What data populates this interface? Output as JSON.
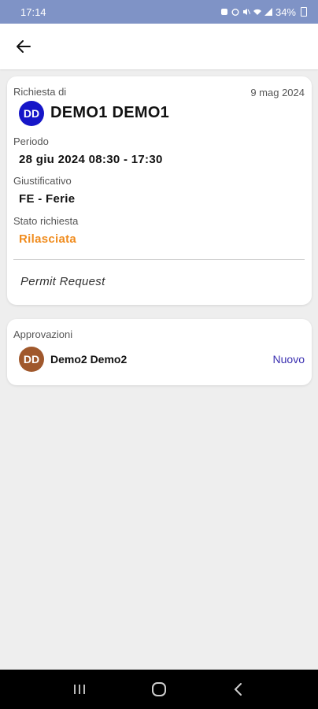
{
  "status_bar": {
    "time": "17:14",
    "battery": "34%"
  },
  "request": {
    "requested_by_label": "Richiesta di",
    "date": "9 mag 2024",
    "requester_initials": "DD",
    "requester_name": "DEMO1 DEMO1",
    "period_label": "Periodo",
    "period_value": "28 giu 2024 08:30 - 17:30",
    "justification_label": "Giustificativo",
    "justification_value": "FE - Ferie",
    "status_label": "Stato richiesta",
    "status_value": "Rilasciata",
    "note": "Permit Request"
  },
  "approvals": {
    "title": "Approvazioni",
    "items": [
      {
        "initials": "DD",
        "name": "Demo2 Demo2",
        "status": "Nuovo"
      }
    ]
  },
  "colors": {
    "status_bar": "#7f93c6",
    "requester_avatar": "#1616c8",
    "approver_avatar": "#a0582c",
    "status_released": "#f08c1e",
    "approval_new": "#3a2fb0"
  }
}
